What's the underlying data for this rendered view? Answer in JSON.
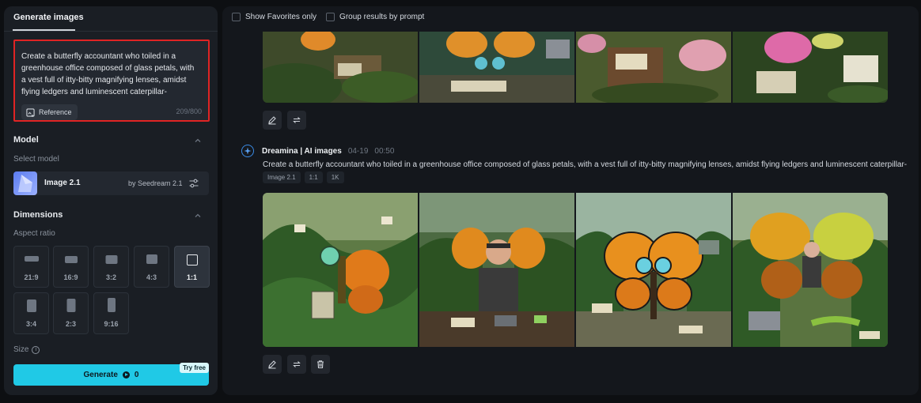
{
  "left": {
    "tab": "Generate images",
    "prompt": "Create a butterfly accountant who toiled in a greenhouse office composed of glass petals, with a vest full of itty-bitty magnifying lenses, amidst flying ledgers and luminescent caterpillar-",
    "reference_label": "Reference",
    "char_count": "209/800",
    "model_section": "Model",
    "select_model": "Select model",
    "model_name": "Image 2.1",
    "model_by": "by Seedream 2.1",
    "dimensions_section": "Dimensions",
    "aspect_ratio_label": "Aspect ratio",
    "ratios": [
      "21:9",
      "16:9",
      "3:2",
      "4:3",
      "1:1",
      "3:4",
      "2:3",
      "9:16"
    ],
    "selected_ratio": "1:1",
    "size_label": "Size",
    "generate_label": "Generate",
    "credits": "0",
    "try_free": "Try free"
  },
  "right": {
    "show_favorites": "Show Favorites only",
    "group_by_prompt": "Group results by prompt",
    "gen_source": "Dreamina | AI images",
    "gen_date": "04-19",
    "gen_time": "00:50",
    "gen_prompt": "Create a butterfly accountant who toiled in a greenhouse office composed of glass petals, with a vest full of itty-bitty magnifying lenses, amidst flying ledgers and luminescent caterpillar-",
    "tags": [
      "Image 2.1",
      "1:1",
      "1K"
    ]
  },
  "colors": {
    "accent": "#20c9e6",
    "highlight_border": "#e02424",
    "panel": "#1a1e24"
  }
}
